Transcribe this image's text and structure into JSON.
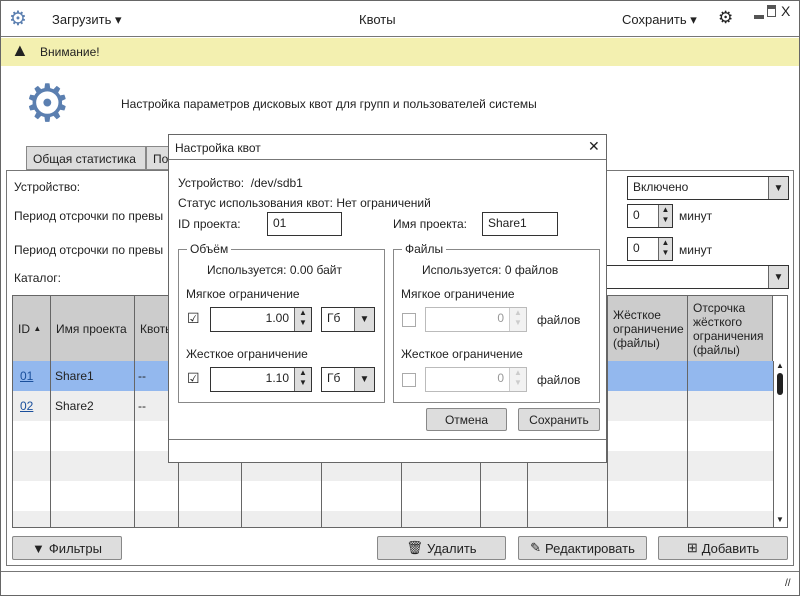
{
  "window": {
    "title": "Квоты",
    "load_menu": "Загрузить",
    "save_menu": "Сохранить"
  },
  "warning": {
    "text": "Внимание!"
  },
  "header": {
    "title": "Настройка параметров дисковых квот для групп и пользователей системы"
  },
  "tabs": [
    {
      "label": "Общая статистика"
    },
    {
      "label": "По"
    }
  ],
  "form": {
    "device_label": "Устройство:",
    "grace1_label": "Период отсрочки по превы",
    "grace2_label": "Период отсрочки по превы",
    "catalog_label": "Каталог:",
    "status_value": "Включено",
    "grace1_value": "0",
    "grace1_unit": "минут",
    "grace2_value": "0",
    "grace2_unit": "минут"
  },
  "table": {
    "headers": [
      "ID",
      "Имя проекта",
      "Квоть",
      "",
      "",
      "",
      "",
      "",
      "Жёсткое ограничение (файлы)",
      "Отсрочка жёсткого ограничения (файлы)"
    ],
    "rows": [
      {
        "id": "01",
        "name": "Share1",
        "quota": "--"
      },
      {
        "id": "02",
        "name": "Share2",
        "quota": "--"
      }
    ]
  },
  "buttons": {
    "filters": "Фильтры",
    "delete": "Удалить",
    "edit": "Редактировать",
    "add": "Добавить"
  },
  "dialog": {
    "title": "Настройка квот",
    "device_label": "Устройство:",
    "device_value": "/dev/sdb1",
    "status_text": "Статус использования квот: Нет ограничений",
    "project_id_label": "ID проекта:",
    "project_id_value": "01",
    "project_name_label": "Имя проекта:",
    "project_name_value": "Share1",
    "volume": {
      "legend": "Объём",
      "used": "Используется:  0.00 байт",
      "soft_label": "Мягкое ограничение",
      "soft_value": "1.00",
      "soft_unit": "Гб",
      "hard_label": "Жесткое ограничение",
      "hard_value": "1.10",
      "hard_unit": "Гб"
    },
    "files": {
      "legend": "Файлы",
      "used": "Используется:  0 файлов",
      "soft_label": "Мягкое ограничение",
      "soft_value": "0",
      "soft_unit": "файлов",
      "hard_label": "Жесткое ограничение",
      "hard_value": "0",
      "hard_unit": "файлов"
    },
    "cancel": "Отмена",
    "save": "Сохранить"
  },
  "colors": {
    "accent": "#5b7fb0",
    "selected_row": "#93b8ee",
    "warning": "#f3f0b0"
  }
}
